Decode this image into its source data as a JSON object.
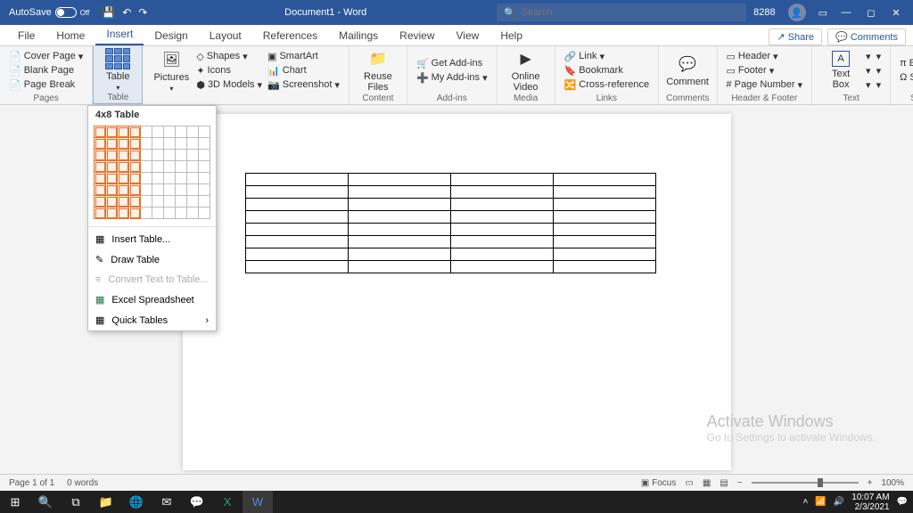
{
  "title": {
    "autosave": "AutoSave",
    "autosave_state": "Off",
    "doc": "Document1 - Word",
    "search_ph": "Search",
    "user": "8288"
  },
  "tabs": [
    "File",
    "Home",
    "Insert",
    "Design",
    "Layout",
    "References",
    "Mailings",
    "Review",
    "View",
    "Help"
  ],
  "share": "Share",
  "comments": "Comments",
  "ribbon": {
    "pages": {
      "label": "Pages",
      "cover": "Cover Page",
      "blank": "Blank Page",
      "break": "Page Break"
    },
    "table": {
      "label": "Table",
      "btn": "Table"
    },
    "illus": {
      "pictures": "Pictures",
      "shapes": "Shapes",
      "icons": "Icons",
      "models": "3D Models",
      "smartart": "SmartArt",
      "chart": "Chart",
      "screenshot": "Screenshot"
    },
    "content": {
      "label": "Content",
      "reuse": "Reuse\nFiles"
    },
    "addins": {
      "label": "Add-ins",
      "get": "Get Add-ins",
      "my": "My Add-ins"
    },
    "media": {
      "label": "Media",
      "online": "Online\nVideo"
    },
    "links": {
      "label": "Links",
      "link": "Link",
      "bookmark": "Bookmark",
      "cross": "Cross-reference"
    },
    "comments": {
      "label": "Comments",
      "comment": "Comment"
    },
    "hf": {
      "label": "Header & Footer",
      "header": "Header",
      "footer": "Footer",
      "page": "Page Number"
    },
    "text": {
      "label": "Text",
      "box": "Text\nBox"
    },
    "symbols": {
      "label": "Symbols",
      "eq": "Equation",
      "sym": "Symbol"
    }
  },
  "tablemenu": {
    "hdr": "4x8 Table",
    "insert": "Insert Table...",
    "draw": "Draw Table",
    "convert": "Convert Text to Table...",
    "excel": "Excel Spreadsheet",
    "quick": "Quick Tables",
    "sel": {
      "cols": 4,
      "rows": 8,
      "totalcols": 10,
      "totalrows": 8
    }
  },
  "watermark": {
    "t": "Activate Windows",
    "s": "Go to Settings to activate Windows."
  },
  "status": {
    "page": "Page 1 of 1",
    "words": "0 words",
    "focus": "Focus",
    "zoom": "100%"
  },
  "tray": {
    "time": "10:07 AM",
    "date": "2/3/2021"
  }
}
